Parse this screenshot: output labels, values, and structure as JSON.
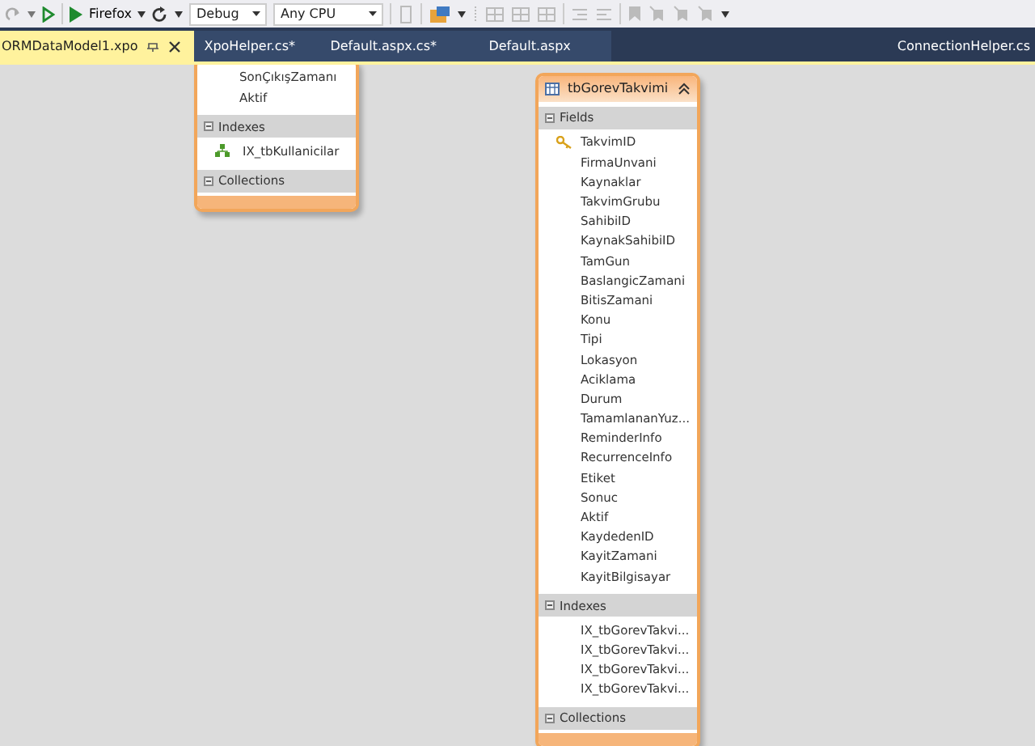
{
  "toolbar": {
    "run_target": "Firefox",
    "configuration": "Debug",
    "platform": "Any CPU"
  },
  "tabs": [
    {
      "label": "ORMDataModel1.xpo",
      "selected": true
    },
    {
      "label": "XpoHelper.cs*",
      "selected": false
    },
    {
      "label": "Default.aspx.cs*",
      "selected": false
    },
    {
      "label": "Default.aspx",
      "selected": false
    }
  ],
  "overflow_tab": {
    "label": "ConnectionHelper.cs"
  },
  "entities": [
    {
      "sections": [
        {
          "items": [
            {
              "label": "SonÇıkışZamanı",
              "kind": "field"
            },
            {
              "label": "Aktif",
              "kind": "field"
            }
          ]
        },
        {
          "label": "Indexes",
          "expanded": true,
          "items": [
            {
              "label": "IX_tbKullanicilar",
              "kind": "index"
            }
          ]
        },
        {
          "label": "Collections",
          "expanded": true
        }
      ]
    },
    {
      "title": "tbGorevTakvimi",
      "sections": [
        {
          "label": "Fields",
          "expanded": true,
          "items": [
            {
              "label": "TakvimID",
              "kind": "key"
            },
            {
              "label": "FirmaUnvani",
              "kind": "field"
            },
            {
              "label": "Kaynaklar",
              "kind": "field"
            },
            {
              "label": "TakvimGrubu",
              "kind": "field"
            },
            {
              "label": "SahibiID",
              "kind": "field"
            },
            {
              "label": "KaynakSahibiID",
              "kind": "field"
            },
            {
              "label": "TamGun",
              "kind": "field"
            },
            {
              "label": "BaslangicZamani",
              "kind": "field"
            },
            {
              "label": "BitisZamani",
              "kind": "field"
            },
            {
              "label": "Konu",
              "kind": "field"
            },
            {
              "label": "Tipi",
              "kind": "field"
            },
            {
              "label": "Lokasyon",
              "kind": "field"
            },
            {
              "label": "Aciklama",
              "kind": "field"
            },
            {
              "label": "Durum",
              "kind": "field"
            },
            {
              "label": "TamamlananYuz...",
              "kind": "field"
            },
            {
              "label": "ReminderInfo",
              "kind": "field"
            },
            {
              "label": "RecurrenceInfo",
              "kind": "field"
            },
            {
              "label": "Etiket",
              "kind": "field"
            },
            {
              "label": "Sonuc",
              "kind": "field"
            },
            {
              "label": "Aktif",
              "kind": "field"
            },
            {
              "label": "KaydedenID",
              "kind": "field"
            },
            {
              "label": "KayitZamani",
              "kind": "field"
            },
            {
              "label": "KayitBilgisayar",
              "kind": "field"
            }
          ]
        },
        {
          "label": "Indexes",
          "expanded": true,
          "items": [
            {
              "label": "IX_tbGorevTakvi...",
              "kind": "field"
            },
            {
              "label": "IX_tbGorevTakvi...",
              "kind": "field"
            },
            {
              "label": "IX_tbGorevTakvi...",
              "kind": "field"
            },
            {
              "label": "IX_tbGorevTakvi...",
              "kind": "field"
            }
          ]
        },
        {
          "label": "Collections",
          "expanded": true
        }
      ]
    }
  ]
}
